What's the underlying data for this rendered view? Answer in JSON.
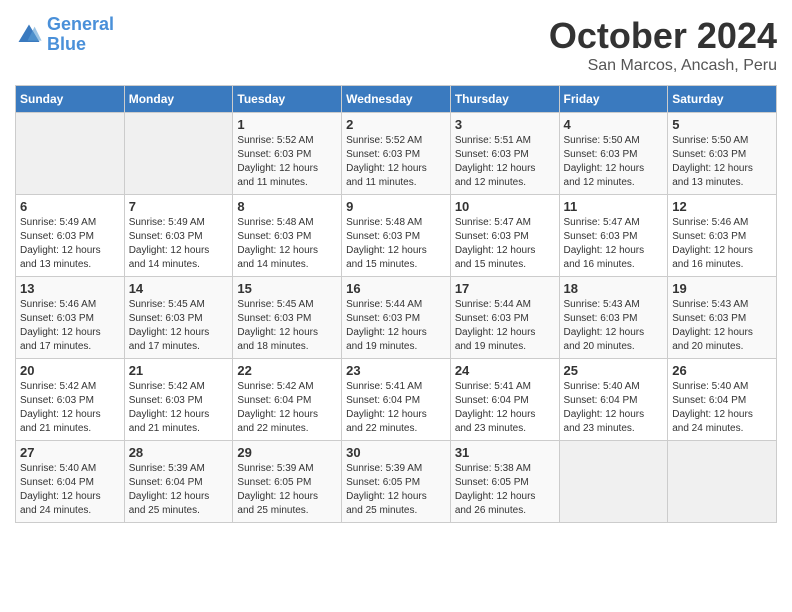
{
  "logo": {
    "line1": "General",
    "line2": "Blue"
  },
  "title": "October 2024",
  "subtitle": "San Marcos, Ancash, Peru",
  "headers": [
    "Sunday",
    "Monday",
    "Tuesday",
    "Wednesday",
    "Thursday",
    "Friday",
    "Saturday"
  ],
  "weeks": [
    [
      {
        "day": "",
        "info": ""
      },
      {
        "day": "",
        "info": ""
      },
      {
        "day": "1",
        "info": "Sunrise: 5:52 AM\nSunset: 6:03 PM\nDaylight: 12 hours and 11 minutes."
      },
      {
        "day": "2",
        "info": "Sunrise: 5:52 AM\nSunset: 6:03 PM\nDaylight: 12 hours and 11 minutes."
      },
      {
        "day": "3",
        "info": "Sunrise: 5:51 AM\nSunset: 6:03 PM\nDaylight: 12 hours and 12 minutes."
      },
      {
        "day": "4",
        "info": "Sunrise: 5:50 AM\nSunset: 6:03 PM\nDaylight: 12 hours and 12 minutes."
      },
      {
        "day": "5",
        "info": "Sunrise: 5:50 AM\nSunset: 6:03 PM\nDaylight: 12 hours and 13 minutes."
      }
    ],
    [
      {
        "day": "6",
        "info": "Sunrise: 5:49 AM\nSunset: 6:03 PM\nDaylight: 12 hours and 13 minutes."
      },
      {
        "day": "7",
        "info": "Sunrise: 5:49 AM\nSunset: 6:03 PM\nDaylight: 12 hours and 14 minutes."
      },
      {
        "day": "8",
        "info": "Sunrise: 5:48 AM\nSunset: 6:03 PM\nDaylight: 12 hours and 14 minutes."
      },
      {
        "day": "9",
        "info": "Sunrise: 5:48 AM\nSunset: 6:03 PM\nDaylight: 12 hours and 15 minutes."
      },
      {
        "day": "10",
        "info": "Sunrise: 5:47 AM\nSunset: 6:03 PM\nDaylight: 12 hours and 15 minutes."
      },
      {
        "day": "11",
        "info": "Sunrise: 5:47 AM\nSunset: 6:03 PM\nDaylight: 12 hours and 16 minutes."
      },
      {
        "day": "12",
        "info": "Sunrise: 5:46 AM\nSunset: 6:03 PM\nDaylight: 12 hours and 16 minutes."
      }
    ],
    [
      {
        "day": "13",
        "info": "Sunrise: 5:46 AM\nSunset: 6:03 PM\nDaylight: 12 hours and 17 minutes."
      },
      {
        "day": "14",
        "info": "Sunrise: 5:45 AM\nSunset: 6:03 PM\nDaylight: 12 hours and 17 minutes."
      },
      {
        "day": "15",
        "info": "Sunrise: 5:45 AM\nSunset: 6:03 PM\nDaylight: 12 hours and 18 minutes."
      },
      {
        "day": "16",
        "info": "Sunrise: 5:44 AM\nSunset: 6:03 PM\nDaylight: 12 hours and 19 minutes."
      },
      {
        "day": "17",
        "info": "Sunrise: 5:44 AM\nSunset: 6:03 PM\nDaylight: 12 hours and 19 minutes."
      },
      {
        "day": "18",
        "info": "Sunrise: 5:43 AM\nSunset: 6:03 PM\nDaylight: 12 hours and 20 minutes."
      },
      {
        "day": "19",
        "info": "Sunrise: 5:43 AM\nSunset: 6:03 PM\nDaylight: 12 hours and 20 minutes."
      }
    ],
    [
      {
        "day": "20",
        "info": "Sunrise: 5:42 AM\nSunset: 6:03 PM\nDaylight: 12 hours and 21 minutes."
      },
      {
        "day": "21",
        "info": "Sunrise: 5:42 AM\nSunset: 6:03 PM\nDaylight: 12 hours and 21 minutes."
      },
      {
        "day": "22",
        "info": "Sunrise: 5:42 AM\nSunset: 6:04 PM\nDaylight: 12 hours and 22 minutes."
      },
      {
        "day": "23",
        "info": "Sunrise: 5:41 AM\nSunset: 6:04 PM\nDaylight: 12 hours and 22 minutes."
      },
      {
        "day": "24",
        "info": "Sunrise: 5:41 AM\nSunset: 6:04 PM\nDaylight: 12 hours and 23 minutes."
      },
      {
        "day": "25",
        "info": "Sunrise: 5:40 AM\nSunset: 6:04 PM\nDaylight: 12 hours and 23 minutes."
      },
      {
        "day": "26",
        "info": "Sunrise: 5:40 AM\nSunset: 6:04 PM\nDaylight: 12 hours and 24 minutes."
      }
    ],
    [
      {
        "day": "27",
        "info": "Sunrise: 5:40 AM\nSunset: 6:04 PM\nDaylight: 12 hours and 24 minutes."
      },
      {
        "day": "28",
        "info": "Sunrise: 5:39 AM\nSunset: 6:04 PM\nDaylight: 12 hours and 25 minutes."
      },
      {
        "day": "29",
        "info": "Sunrise: 5:39 AM\nSunset: 6:05 PM\nDaylight: 12 hours and 25 minutes."
      },
      {
        "day": "30",
        "info": "Sunrise: 5:39 AM\nSunset: 6:05 PM\nDaylight: 12 hours and 25 minutes."
      },
      {
        "day": "31",
        "info": "Sunrise: 5:38 AM\nSunset: 6:05 PM\nDaylight: 12 hours and 26 minutes."
      },
      {
        "day": "",
        "info": ""
      },
      {
        "day": "",
        "info": ""
      }
    ]
  ]
}
